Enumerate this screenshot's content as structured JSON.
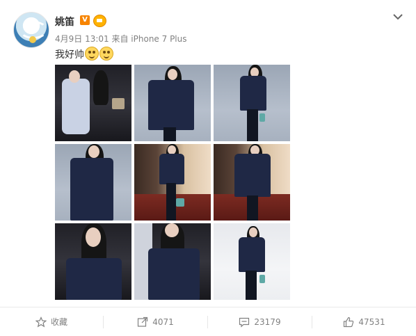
{
  "post": {
    "author": "姚笛",
    "badge_v": "V",
    "meta": "4月9日 13:01 来自 iPhone 7 Plus",
    "text": "我好帅"
  },
  "icons": {
    "menu": "chevron-down-icon",
    "verified": "verified-v-icon",
    "vip": "vip-badge-icon",
    "favorite": "star-icon",
    "repost": "repost-icon",
    "comment": "comment-icon",
    "like": "thumbs-up-icon"
  },
  "actions": {
    "favorite_label": "收藏",
    "repost_count": "4071",
    "comment_count": "23179",
    "like_count": "47531"
  },
  "colors": {
    "verified_orange": "#f78400",
    "text_grey": "#808080",
    "coat_navy": "#1f2845"
  }
}
